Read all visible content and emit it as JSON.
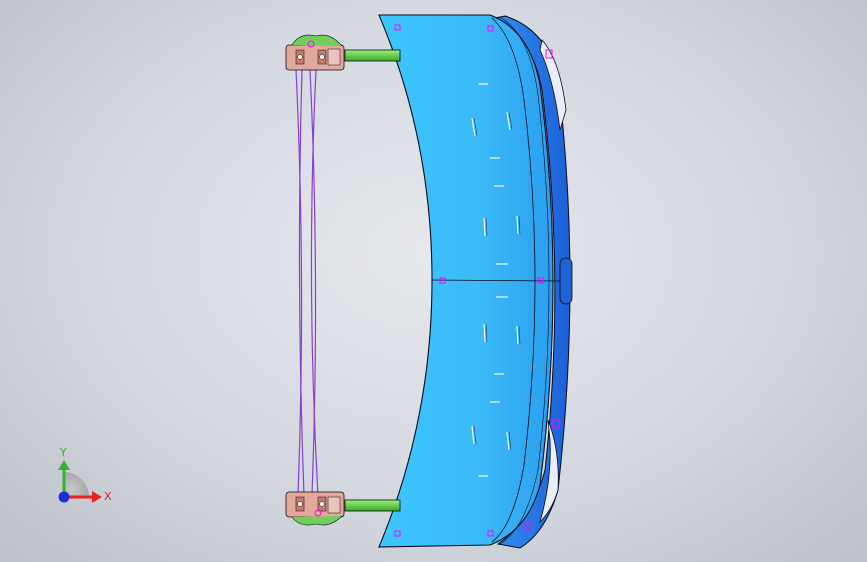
{
  "viewport": {
    "background_top": "#e6e8ed",
    "background_bottom": "#bcc1ca"
  },
  "model": {
    "panel_color": "#35b8f5",
    "panel_light": "#5fd3ff",
    "panel_dark": "#1f7fe0",
    "edge_color": "#0a0a1a",
    "sketch_color": "#ff00ff",
    "strut_color": "#55dd33",
    "cable_color": "#8a3fd0",
    "bracket_color": "#e2a899"
  },
  "triad": {
    "x_label": "X",
    "y_label": "Y",
    "x_color": "#e8221f",
    "y_color": "#2fb52f",
    "z_color": "#1a2fd6"
  }
}
